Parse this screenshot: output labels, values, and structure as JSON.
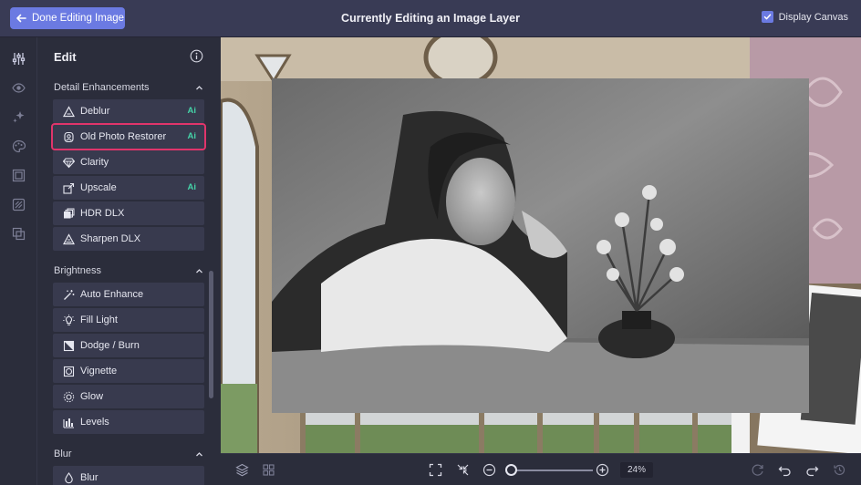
{
  "topbar": {
    "done_label": "Done Editing Image",
    "title": "Currently Editing an Image Layer",
    "display_canvas_label": "Display Canvas",
    "display_canvas_checked": true
  },
  "rail": {
    "icons": [
      "sliders-icon",
      "eye-icon",
      "sparkle-icon",
      "palette-icon",
      "frame-icon",
      "texture-icon",
      "overlay-icon"
    ]
  },
  "panel": {
    "title": "Edit",
    "sections": [
      {
        "title": "Detail Enhancements",
        "items": [
          {
            "label": "Deblur",
            "ai": "Ai",
            "icon": "triangle-icon"
          },
          {
            "label": "Old Photo Restorer",
            "ai": "Ai",
            "icon": "restore-icon",
            "selected": true
          },
          {
            "label": "Clarity",
            "icon": "diamond-icon"
          },
          {
            "label": "Upscale",
            "ai": "Ai",
            "icon": "upscale-icon"
          },
          {
            "label": "HDR DLX",
            "icon": "hdr-icon"
          },
          {
            "label": "Sharpen DLX",
            "icon": "sharpen-icon"
          }
        ]
      },
      {
        "title": "Brightness",
        "items": [
          {
            "label": "Auto Enhance",
            "icon": "magic-wand-icon"
          },
          {
            "label": "Fill Light",
            "icon": "bulb-icon"
          },
          {
            "label": "Dodge / Burn",
            "icon": "dodge-burn-icon"
          },
          {
            "label": "Vignette",
            "icon": "vignette-icon"
          },
          {
            "label": "Glow",
            "icon": "glow-icon"
          },
          {
            "label": "Levels",
            "icon": "levels-icon"
          }
        ]
      },
      {
        "title": "Blur",
        "items": [
          {
            "label": "Blur",
            "icon": "drop-icon"
          }
        ]
      }
    ]
  },
  "bottombar": {
    "zoom_value": "24%",
    "zoom_level": 0.24
  },
  "colors": {
    "accent": "#6b7ae2",
    "ai_badge": "#45d3a8",
    "highlight": "#e0356b",
    "panel_bg": "#2b2d3b",
    "item_bg": "#383a4e"
  }
}
